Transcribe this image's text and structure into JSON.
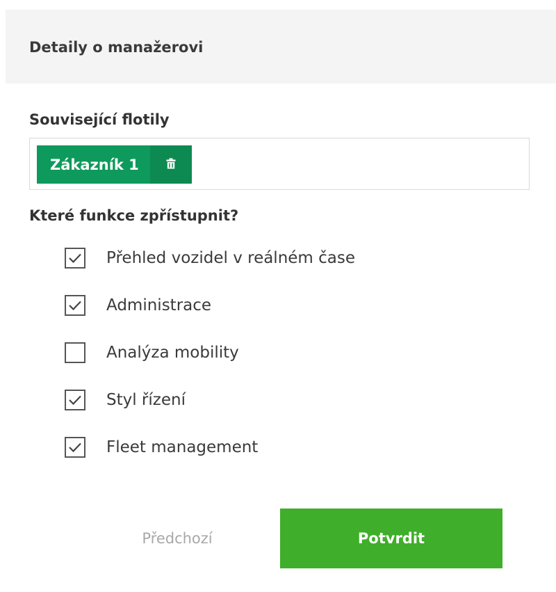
{
  "header": {
    "title": "Detaily o manažerovi"
  },
  "fleets": {
    "label": "Související flotily",
    "chips": [
      {
        "label": "Zákazník 1",
        "delete_icon": "trash-icon"
      }
    ]
  },
  "features": {
    "label": "Které funkce zpřístupnit?",
    "items": [
      {
        "label": "Přehled vozidel v reálném čase",
        "checked": true
      },
      {
        "label": "Administrace",
        "checked": true
      },
      {
        "label": "Analýza mobility",
        "checked": false
      },
      {
        "label": "Styl řízení",
        "checked": true
      },
      {
        "label": "Fleet management",
        "checked": true
      }
    ]
  },
  "actions": {
    "previous_label": "Předchozí",
    "confirm_label": "Potvrdit"
  },
  "colors": {
    "chip": "#0e9a5c",
    "chip_delete": "#0c8a52",
    "confirm": "#3fae2a",
    "header_bg": "#f4f4f4"
  }
}
